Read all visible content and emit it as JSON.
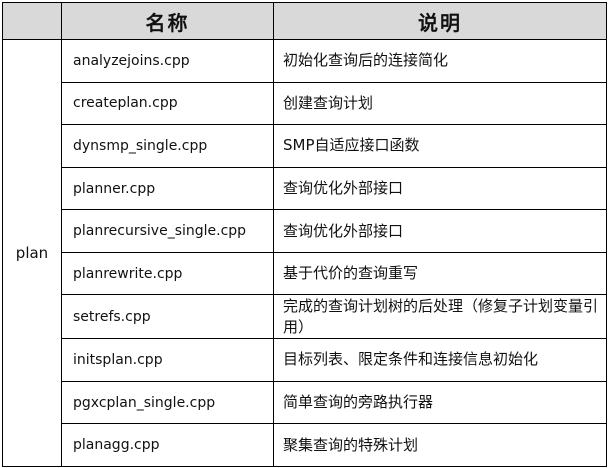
{
  "table": {
    "headers": [
      "",
      "名称",
      "说明"
    ],
    "group_label": "plan",
    "rows": [
      {
        "name": "analyzejoins.cpp",
        "desc": "初始化查询后的连接简化"
      },
      {
        "name": "createplan.cpp",
        "desc": "创建查询计划"
      },
      {
        "name": "dynsmp_single.cpp",
        "desc": "SMP自适应接口函数"
      },
      {
        "name": "planner.cpp",
        "desc": "查询优化外部接口"
      },
      {
        "name": "planrecursive_single.cpp",
        "desc": "查询优化外部接口"
      },
      {
        "name": "planrewrite.cpp",
        "desc": "基于代价的查询重写"
      },
      {
        "name": "setrefs.cpp",
        "desc": "完成的查询计划树的后处理（修复子计划变量引用）"
      },
      {
        "name": "initsplan.cpp",
        "desc": "目标列表、限定条件和连接信息初始化"
      },
      {
        "name": "pgxcplan_single.cpp",
        "desc": "简单查询的旁路执行器"
      },
      {
        "name": "planagg.cpp",
        "desc": "聚集查询的特殊计划"
      }
    ]
  }
}
